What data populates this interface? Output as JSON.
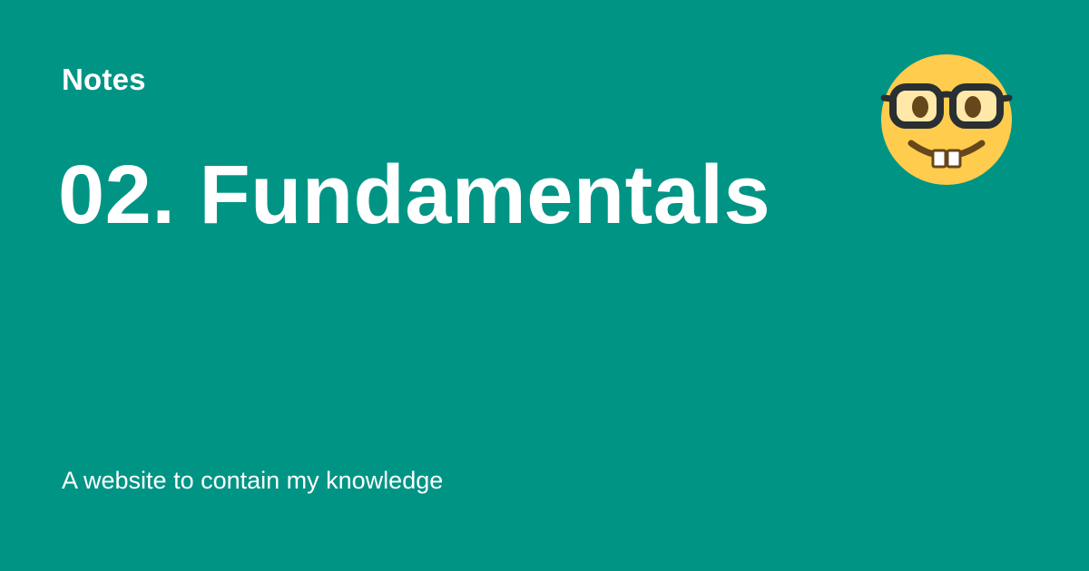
{
  "site": {
    "name": "Notes"
  },
  "page": {
    "title": "02. Fundamentals",
    "description": "A website to contain my knowledge"
  },
  "theme": {
    "background": "#009485",
    "text": "#ffffff",
    "emoji_face": "#FFCC4D",
    "emoji_dark": "#292F33",
    "emoji_eye": "#65471B"
  },
  "logo": {
    "icon": "nerd-face-icon"
  }
}
